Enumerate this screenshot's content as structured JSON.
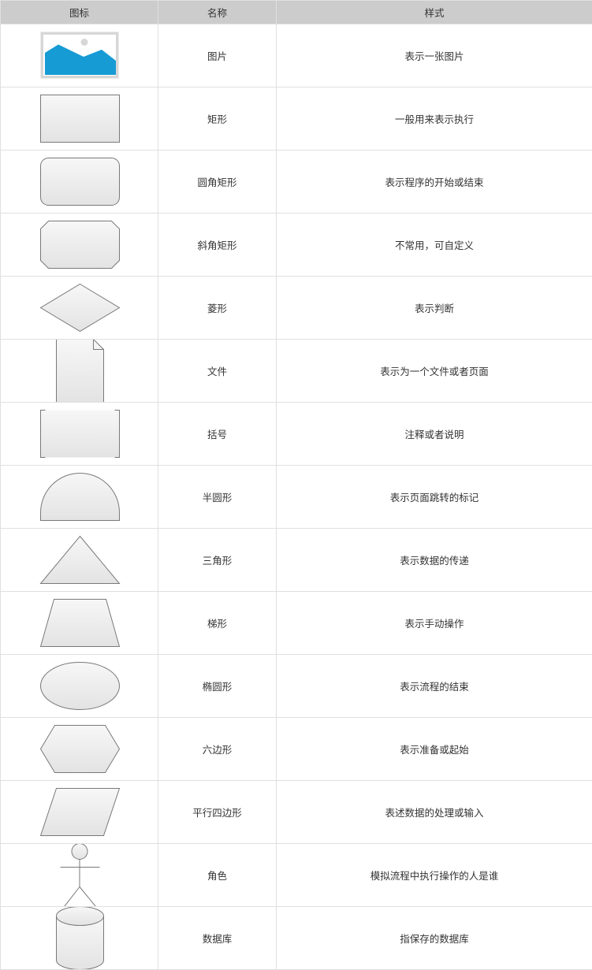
{
  "header": {
    "col_icon": "图标",
    "col_name": "名称",
    "col_style": "样式"
  },
  "rows": [
    {
      "icon": "image-icon",
      "name": "图片",
      "style": "表示一张图片"
    },
    {
      "icon": "rectangle-icon",
      "name": "矩形",
      "style": "一般用来表示执行"
    },
    {
      "icon": "rounded-rectangle-icon",
      "name": "圆角矩形",
      "style": "表示程序的开始或结束"
    },
    {
      "icon": "beveled-rectangle-icon",
      "name": "斜角矩形",
      "style": "不常用，可自定义"
    },
    {
      "icon": "diamond-icon",
      "name": "菱形",
      "style": "表示判断"
    },
    {
      "icon": "document-icon",
      "name": "文件",
      "style": "表示为一个文件或者页面"
    },
    {
      "icon": "bracket-icon",
      "name": "括号",
      "style": "注释或者说明"
    },
    {
      "icon": "semicircle-icon",
      "name": "半圆形",
      "style": "表示页面跳转的标记"
    },
    {
      "icon": "triangle-icon",
      "name": "三角形",
      "style": "表示数据的传递"
    },
    {
      "icon": "trapezoid-icon",
      "name": "梯形",
      "style": "表示手动操作"
    },
    {
      "icon": "ellipse-icon",
      "name": "椭圆形",
      "style": "表示流程的结束"
    },
    {
      "icon": "hexagon-icon",
      "name": "六边形",
      "style": "表示准备或起始"
    },
    {
      "icon": "parallelogram-icon",
      "name": "平行四边形",
      "style": "表述数据的处理或输入"
    },
    {
      "icon": "actor-icon",
      "name": "角色",
      "style": "模拟流程中执行操作的人是谁"
    },
    {
      "icon": "database-icon",
      "name": "数据库",
      "style": "指保存的数据库"
    }
  ],
  "colors": {
    "header_bg": "#cccccc",
    "grid_line": "#e0e0e0",
    "shape_fill_top": "#f7f7f7",
    "shape_fill_bottom": "#e3e3e3",
    "shape_stroke": "#797979",
    "image_blue": "#169bd5",
    "image_frame": "#d7d7d7"
  }
}
